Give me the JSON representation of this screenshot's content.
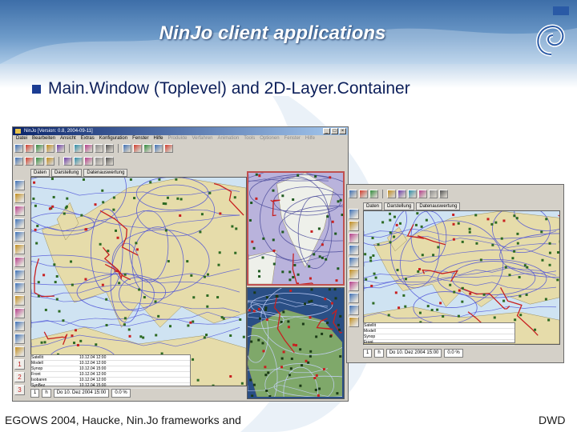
{
  "slide": {
    "title": "NinJo client applications",
    "bullet": "Main.Window (Toplevel) and 2D-Layer.Container",
    "footer_left": "EGOWS 2004, Haucke, Nin.Jo frameworks and",
    "footer_right": "DWD",
    "logo_text": "DWD"
  },
  "main_window": {
    "title": "NinJo [Version: 0.8, 2004-09-11]",
    "menu": [
      {
        "label": "Datei",
        "enabled": true
      },
      {
        "label": "Bearbeiten",
        "enabled": true
      },
      {
        "label": "Ansicht",
        "enabled": true
      },
      {
        "label": "Extras",
        "enabled": true
      },
      {
        "label": "Konfiguration",
        "enabled": true
      },
      {
        "label": "Fenster",
        "enabled": true
      },
      {
        "label": "Hilfe",
        "enabled": true
      },
      {
        "label": "Produkte",
        "enabled": false
      },
      {
        "label": "Verfahren",
        "enabled": false
      },
      {
        "label": "Animation",
        "enabled": false
      },
      {
        "label": "Tools",
        "enabled": false
      },
      {
        "label": "Optionen",
        "enabled": false
      },
      {
        "label": "Fenster",
        "enabled": false
      },
      {
        "label": "Hilfe",
        "enabled": false
      }
    ],
    "subtabs": [
      "Daten",
      "Darstellung",
      "Datenauswertung"
    ],
    "statusbar": [
      "1",
      "h",
      "Do 10. Dez 2004 15:00",
      "0.0 %"
    ],
    "layer_rows": [
      "Satellit",
      "Modell",
      "Synop",
      "Front",
      "Isobaren",
      "SynBez"
    ],
    "layer_times": [
      "10.12.04 12:00",
      "10.12.04 12:00",
      "10.12.04 15:00",
      "10.12.04 12:00",
      "10.12.04 12:00",
      "10.12.04 15:00"
    ],
    "side_numbers": [
      "1",
      "2",
      "3"
    ]
  },
  "second_window": {
    "subtabs": [
      "Daten",
      "Darstellung",
      "Datenauswertung"
    ],
    "statusbar": [
      "1",
      "h",
      "Do 10. Dez 2004 15:00",
      "0.0 %"
    ],
    "layer_rows": [
      "Satellit",
      "Modell",
      "Synop",
      "Front"
    ]
  },
  "colors": {
    "sky_band": "#5f8cc0",
    "bullet": "#1b3d93",
    "sea": "#cfe3f2",
    "land": "#e6dcaa",
    "isobar": "#4a4fd8",
    "front": "#c82020",
    "station": "#2c6a22"
  },
  "icons": [
    "app-icon",
    "minimize-icon",
    "maximize-icon",
    "close-icon",
    "dwd-spiral-icon"
  ]
}
